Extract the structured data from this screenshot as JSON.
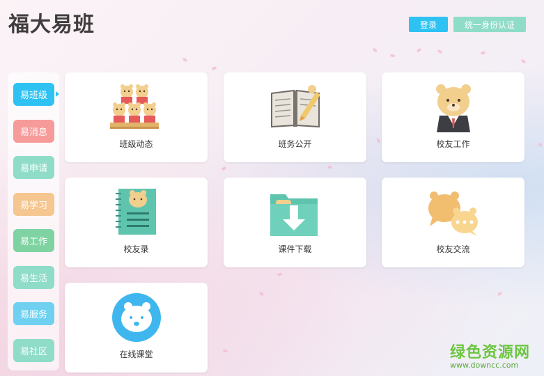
{
  "header": {
    "logo": "福大易班",
    "login_label": "登录",
    "auth_label": "统一身份认证"
  },
  "sidebar": {
    "items": [
      {
        "label": "易班级",
        "color": "#2ec2f3"
      },
      {
        "label": "易消息",
        "color": "#f69a9a"
      },
      {
        "label": "易申请",
        "color": "#8fdcc8"
      },
      {
        "label": "易学习",
        "color": "#f5c68f"
      },
      {
        "label": "易工作",
        "color": "#7fd3a3"
      },
      {
        "label": "易生活",
        "color": "#8fdcc8"
      },
      {
        "label": "易服务",
        "color": "#6fd0f0"
      },
      {
        "label": "易社区",
        "color": "#8fdcc8"
      }
    ],
    "active_index": 0
  },
  "cards": [
    {
      "label": "班级动态",
      "icon": "bear-class-icon"
    },
    {
      "label": "班务公开",
      "icon": "open-book-icon"
    },
    {
      "label": "校友工作",
      "icon": "bear-suit-icon"
    },
    {
      "label": "校友录",
      "icon": "notebook-icon"
    },
    {
      "label": "课件下载",
      "icon": "folder-download-icon"
    },
    {
      "label": "校友交流",
      "icon": "chat-bubbles-icon"
    },
    {
      "label": "在线课堂",
      "icon": "bear-circle-icon"
    }
  ],
  "watermark": {
    "title": "绿色资源网",
    "url": "www.downcc.com"
  }
}
